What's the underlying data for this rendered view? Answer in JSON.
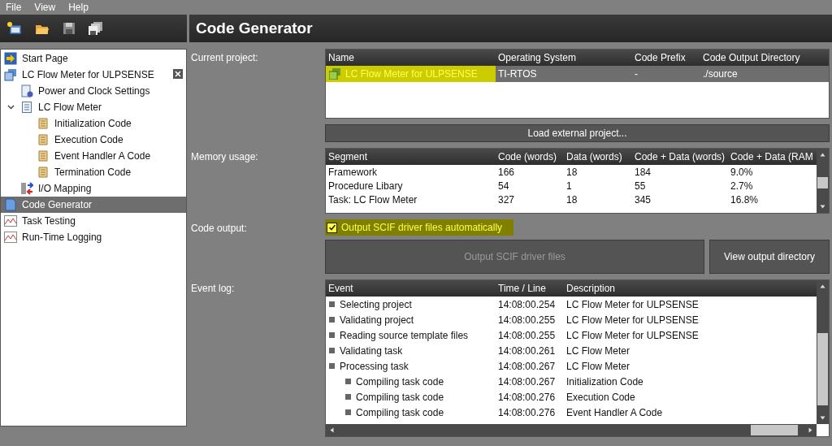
{
  "menu": [
    {
      "label": "File"
    },
    {
      "label": "View"
    },
    {
      "label": "Help"
    }
  ],
  "toolbar": [
    {
      "kind": "new"
    },
    {
      "kind": "open"
    },
    {
      "kind": "save"
    },
    {
      "kind": "save-all"
    }
  ],
  "sidebar": {
    "items": [
      {
        "label": "Start Page",
        "kind": "start",
        "selected": false
      },
      {
        "label": "LC Flow Meter for ULPSENSE",
        "kind": "project",
        "selected": false,
        "closable": true,
        "children": [
          {
            "label": "Power and Clock Settings",
            "kind": "settings",
            "selected": false
          },
          {
            "label": "LC Flow Meter",
            "kind": "task",
            "selected": false,
            "expanded": true,
            "children": [
              {
                "label": "Initialization Code",
                "kind": "code",
                "selected": false
              },
              {
                "label": "Execution Code",
                "kind": "code",
                "selected": false
              },
              {
                "label": "Event Handler A Code",
                "kind": "code",
                "selected": false
              },
              {
                "label": "Termination Code",
                "kind": "code",
                "selected": false
              }
            ]
          },
          {
            "label": "I/O Mapping",
            "kind": "io",
            "selected": false
          }
        ]
      },
      {
        "label": "Code Generator",
        "kind": "generator",
        "selected": true
      },
      {
        "label": "Task Testing",
        "kind": "chart",
        "selected": false
      },
      {
        "label": "Run-Time Logging",
        "kind": "chart",
        "selected": false
      }
    ]
  },
  "page_title": "Code Generator",
  "current_project": {
    "label": "Current project:",
    "columns": [
      "Name",
      "Operating System",
      "Code Prefix",
      "Code Output Directory"
    ],
    "rows": [
      {
        "cells": [
          "LC Flow Meter for ULPSENSE",
          "TI-RTOS",
          "-",
          "./source"
        ],
        "selected": true,
        "highlighted": true
      }
    ]
  },
  "load_button": "Load external project...",
  "memory_usage": {
    "label": "Memory usage:",
    "columns": [
      "Segment",
      "Code  (words)",
      "Data  (words)",
      "Code + Data  (words)",
      "Code + Data  (RAM"
    ],
    "rows": [
      [
        "Framework",
        "166",
        "18",
        "184",
        "9.0%"
      ],
      [
        "Procedure Libary",
        "54",
        "1",
        "55",
        "2.7%"
      ],
      [
        "Task: LC Flow Meter",
        "327",
        "18",
        "345",
        "16.8%"
      ]
    ]
  },
  "code_output": {
    "label": "Code output:",
    "checkbox": {
      "label": "Output SCIF driver files automatically",
      "checked": true,
      "highlighted": true
    },
    "buttons": [
      {
        "label": "Output SCIF driver files",
        "disabled": true
      },
      {
        "label": "View output directory",
        "disabled": false
      }
    ]
  },
  "event_log": {
    "label": "Event log:",
    "columns": [
      "Event",
      "Time / Line",
      "Description"
    ],
    "rows": [
      {
        "event": "Selecting project",
        "time": "14:08:00.254",
        "description": "LC Flow Meter for ULPSENSE"
      },
      {
        "event": "Validating project",
        "time": "14:08:00.255",
        "description": "LC Flow Meter for ULPSENSE"
      },
      {
        "event": "Reading source template files",
        "time": "14:08:00.255",
        "description": "LC Flow Meter for ULPSENSE"
      },
      {
        "event": "Validating task",
        "time": "14:08:00.261",
        "description": "LC Flow Meter"
      },
      {
        "event": "Processing task",
        "time": "14:08:00.267",
        "description": "LC Flow Meter",
        "children": [
          {
            "event": "Compiling task code",
            "time": "14:08:00.267",
            "description": "Initialization Code"
          },
          {
            "event": "Compiling task code",
            "time": "14:08:00.276",
            "description": "Execution Code"
          },
          {
            "event": "Compiling task code",
            "time": "14:08:00.276",
            "description": "Event Handler A Code"
          }
        ]
      }
    ]
  }
}
